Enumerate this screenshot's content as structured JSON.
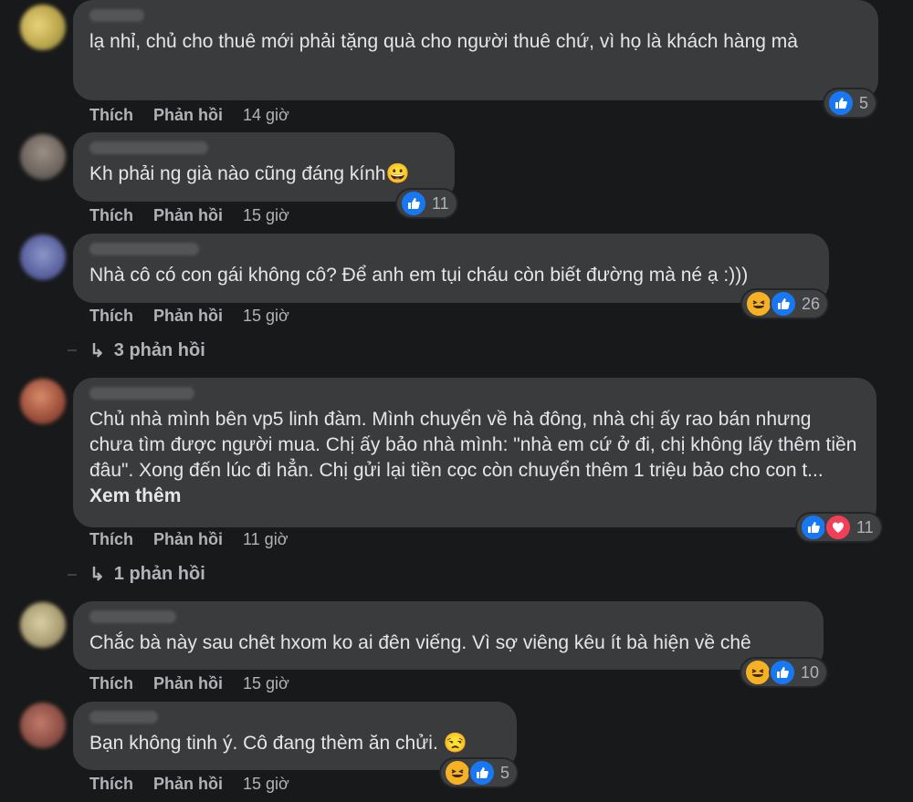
{
  "comments": [
    {
      "text": "lạ nhỉ, chủ cho thuê mới phải tặng quà cho người thuê chứ, vì họ là khách hàng mà",
      "like_label": "Thích",
      "reply_label": "Phản hồi",
      "time": "14 giờ",
      "reactions": [
        "like-icon"
      ],
      "reaction_count": "5"
    },
    {
      "text": "Kh phải ng già nào cũng đáng kính😀",
      "like_label": "Thích",
      "reply_label": "Phản hồi",
      "time": "15 giờ",
      "reactions": [
        "like-icon"
      ],
      "reaction_count": "11"
    },
    {
      "text": "Nhà cô có con gái không cô? Để anh em tụi cháu còn biết đường mà né ạ :)))",
      "like_label": "Thích",
      "reply_label": "Phản hồi",
      "time": "15 giờ",
      "reactions": [
        "haha-icon",
        "like-icon"
      ],
      "reaction_count": "26",
      "replies_label": "3 phản hồi"
    },
    {
      "text": "Chủ nhà mình bên vp5 linh đàm. Mình chuyển về hà đông, nhà chị ấy rao bán nhưng chưa tìm được người mua. Chị ấy bảo nhà mình: \"nhà em cứ ở đi, chị không lấy thêm tiền đâu\". Xong đến lúc đi hẳn. Chị gửi lại tiền cọc còn chuyển thêm 1 triệu bảo cho con t...",
      "see_more": "Xem thêm",
      "like_label": "Thích",
      "reply_label": "Phản hồi",
      "time": "11 giờ",
      "reactions": [
        "like-icon",
        "love-icon"
      ],
      "reaction_count": "11",
      "replies_label": "1 phản hồi"
    },
    {
      "text": "Chắc bà này sau chêt hxom ko ai đên viếng. Vì sợ viêng kêu ít bà hiện về chê",
      "like_label": "Thích",
      "reply_label": "Phản hồi",
      "time": "15 giờ",
      "reactions": [
        "haha-icon",
        "like-icon"
      ],
      "reaction_count": "10"
    },
    {
      "text": "Bạn không tinh ý. Cô đang thèm ăn chửi. 😒",
      "like_label": "Thích",
      "reply_label": "Phản hồi",
      "time": "15 giờ",
      "reactions": [
        "haha-icon",
        "like-icon"
      ],
      "reaction_count": "5"
    }
  ],
  "colors": {
    "background": "#18191a",
    "bubble": "#3a3b3c",
    "text": "#e4e6eb",
    "secondary_text": "#b0b3b8",
    "like": "#1877f2",
    "love": "#f33e58",
    "haha": "#f7b125"
  }
}
